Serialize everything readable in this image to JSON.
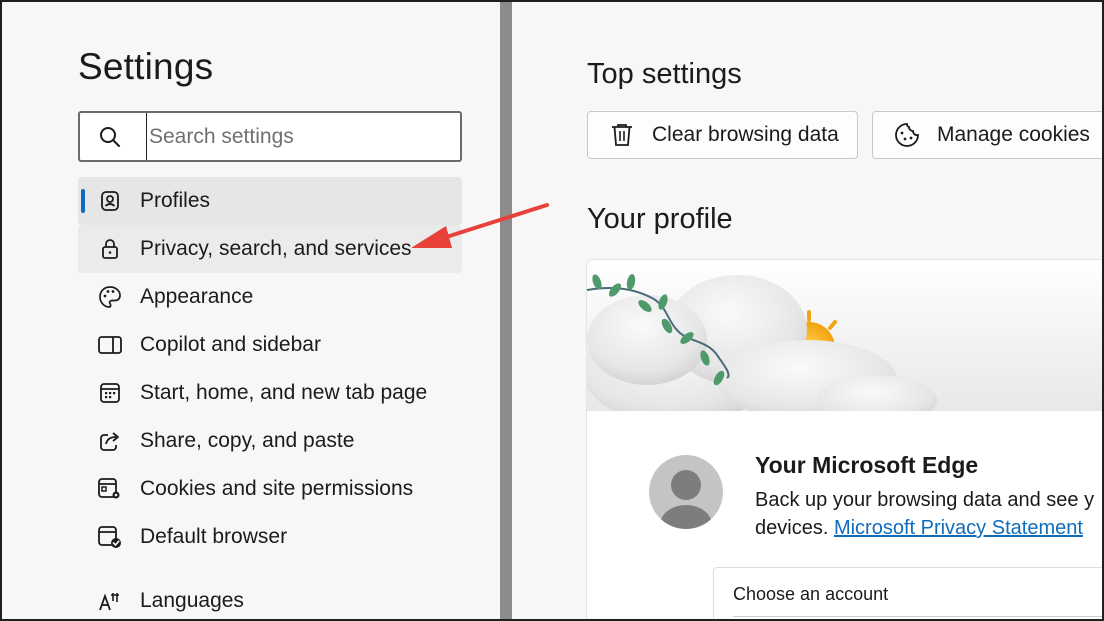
{
  "sidebar": {
    "title": "Settings",
    "search": {
      "placeholder": "Search settings",
      "value": ""
    },
    "items": [
      {
        "label": "Profiles",
        "icon": "profile-icon",
        "state": "active"
      },
      {
        "label": "Privacy, search, and services",
        "icon": "lock-icon",
        "state": "hover"
      },
      {
        "label": "Appearance",
        "icon": "palette-icon",
        "state": ""
      },
      {
        "label": "Copilot and sidebar",
        "icon": "sidebar-icon",
        "state": ""
      },
      {
        "label": "Start, home, and new tab page",
        "icon": "start-page-icon",
        "state": ""
      },
      {
        "label": "Share, copy, and paste",
        "icon": "share-icon",
        "state": ""
      },
      {
        "label": "Cookies and site permissions",
        "icon": "cookies-permissions-icon",
        "state": ""
      },
      {
        "label": "Default browser",
        "icon": "default-browser-icon",
        "state": ""
      },
      {
        "label": "Languages",
        "icon": "languages-icon",
        "state": ""
      }
    ]
  },
  "main": {
    "top_settings_title": "Top settings",
    "buttons": [
      {
        "label": "Clear browsing data",
        "icon": "trash-icon"
      },
      {
        "label": "Manage cookies",
        "icon": "cookie-icon"
      }
    ],
    "profile_title": "Your profile",
    "profile_card": {
      "heading": "Your Microsoft Edge",
      "text": "Back up your browsing data and see y devices.",
      "text_line1": "Back up your browsing data and see y",
      "text_line2_prefix": "devices. ",
      "link": "Microsoft Privacy Statement",
      "choose_account": "Choose an account"
    }
  },
  "colors": {
    "accent": "#0f6cbd",
    "annotation_arrow": "#e8413a",
    "sidebar_bg": "#f7f7f7",
    "divider": "#8c8c8c"
  }
}
